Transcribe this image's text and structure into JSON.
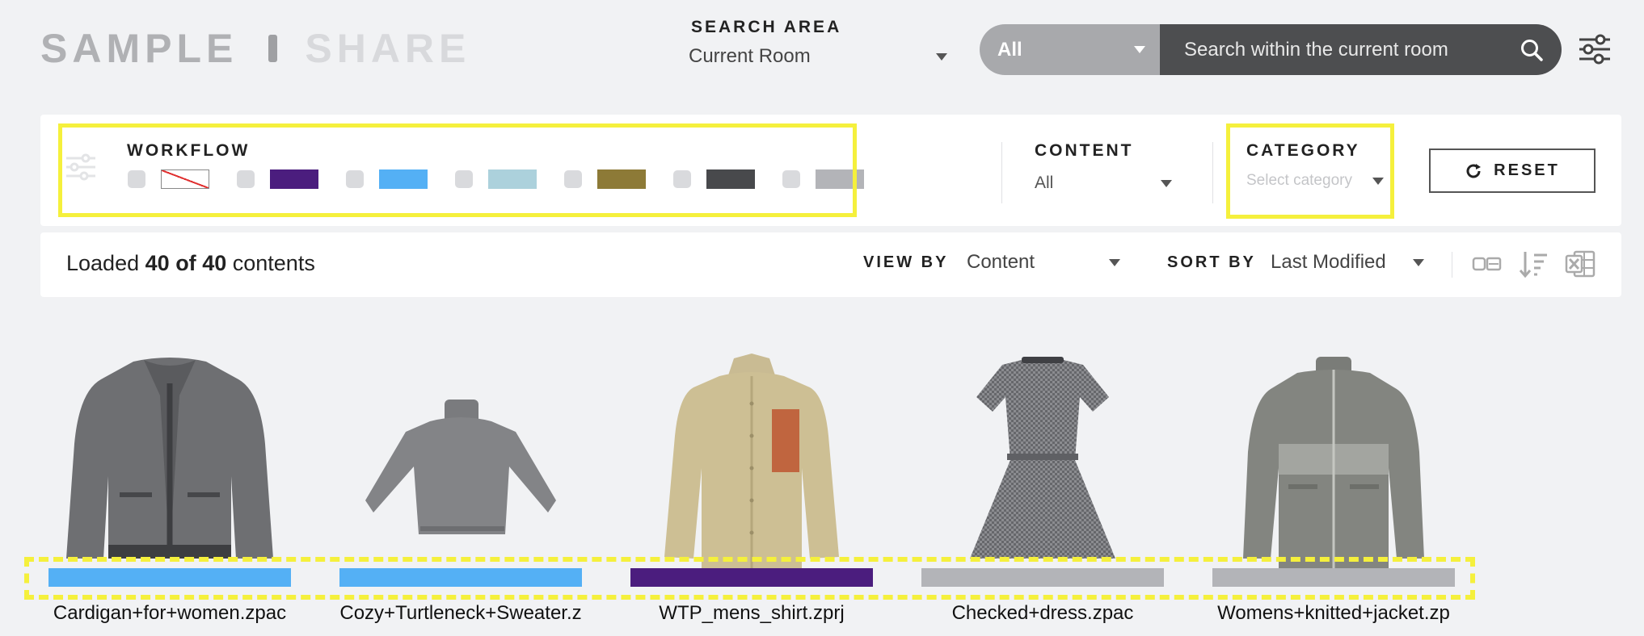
{
  "header": {
    "brand_primary": "SAMPLE",
    "brand_secondary": "SHARE",
    "search_area_label": "SEARCH AREA",
    "search_area_value": "Current Room",
    "search_scope": "All",
    "search_placeholder": "Search within the current room"
  },
  "filters": {
    "workflow_label": "WORKFLOW",
    "workflow_swatches": [
      "none",
      "#4b1d7e",
      "#54b0f5",
      "#acd1dc",
      "#8d7a37",
      "#48494c",
      "#b3b4b8"
    ],
    "content_label": "CONTENT",
    "content_value": "All",
    "category_label": "CATEGORY",
    "category_placeholder": "Select category",
    "reset_label": "RESET"
  },
  "results": {
    "loaded_prefix": "Loaded",
    "loaded_count": "40",
    "loaded_of": "of",
    "loaded_total": "40",
    "loaded_suffix": "contents",
    "view_by_label": "VIEW BY",
    "view_by_value": "Content",
    "sort_by_label": "SORT BY",
    "sort_by_value": "Last Modified"
  },
  "items": [
    {
      "name": "Cardigan+for+women.zpac",
      "workflow_color": "#54b0f5",
      "icon": "cardigan-thumbnail"
    },
    {
      "name": "Cozy+Turtleneck+Sweater.z",
      "workflow_color": "#54b0f5",
      "icon": "turtleneck-thumbnail"
    },
    {
      "name": "WTP_mens_shirt.zprj",
      "workflow_color": "#4b1d7e",
      "icon": "shirt-thumbnail"
    },
    {
      "name": "Checked+dress.zpac",
      "workflow_color": "#b3b4b8",
      "icon": "dress-thumbnail"
    },
    {
      "name": "Womens+knitted+jacket.zp",
      "workflow_color": "#b3b4b8",
      "icon": "jacket-thumbnail"
    }
  ],
  "colors": {
    "highlight": "#f5f03c",
    "search_dark": "#4d4e50",
    "search_scope": "#a8a9ac"
  }
}
